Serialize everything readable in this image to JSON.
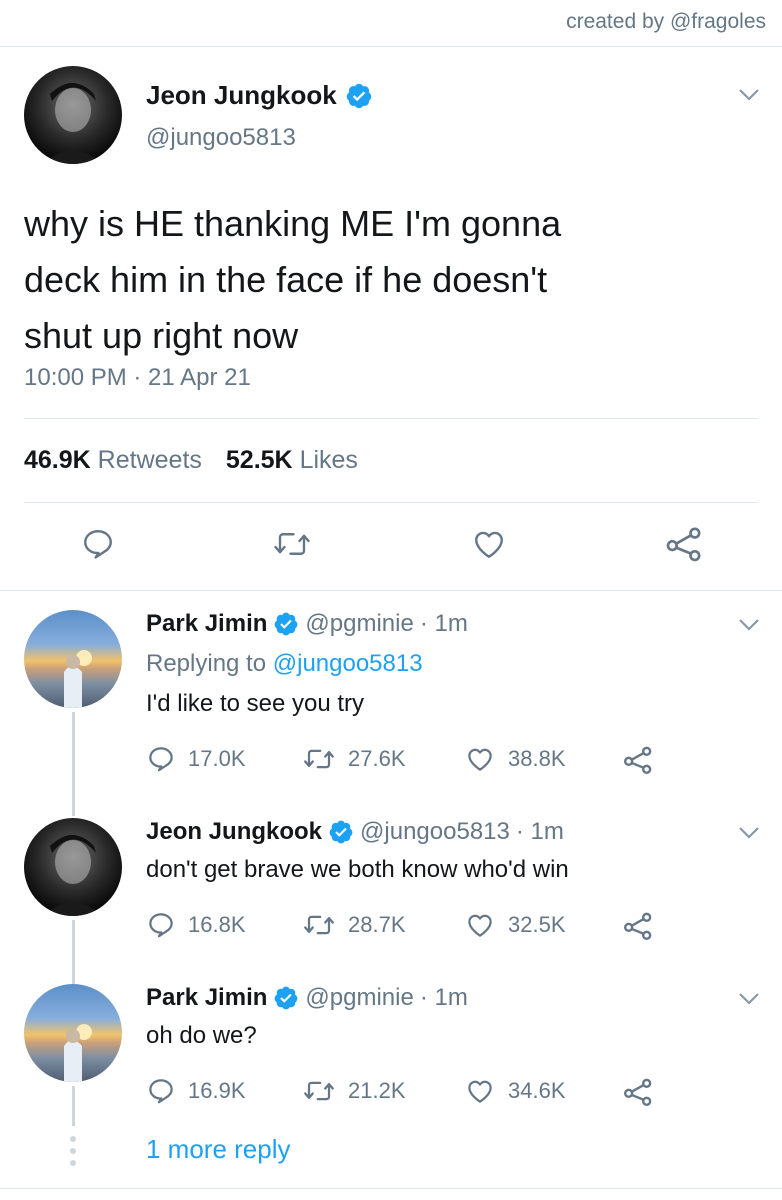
{
  "credit": "created by @fragoles",
  "main_tweet": {
    "name": "Jeon Jungkook",
    "handle": "@jungoo5813",
    "text_lines": [
      "why is HE thanking ME I'm gonna",
      "deck him in the face if he doesn't",
      "shut up right now"
    ],
    "timestamp": "10:00 PM · 21 Apr 21",
    "retweets_count": "46.9K",
    "retweets_label": "Retweets",
    "likes_count": "52.5K",
    "likes_label": "Likes"
  },
  "replies": [
    {
      "name": "Park Jimin",
      "handle": "@pgminie",
      "time": "· 1m",
      "replying_prefix": "Replying to",
      "replying_handle": "@jungoo5813",
      "text": "I'd like to see you try",
      "replies": "17.0K",
      "retweets": "27.6K",
      "likes": "38.8K"
    },
    {
      "name": "Jeon Jungkook",
      "handle": "@jungoo5813",
      "time": "· 1m",
      "text": "don't get brave we both know who'd win",
      "replies": "16.8K",
      "retweets": "28.7K",
      "likes": "32.5K"
    },
    {
      "name": "Park Jimin",
      "handle": "@pgminie",
      "time": "· 1m",
      "text": "oh do we?",
      "replies": "16.9K",
      "retweets": "21.2K",
      "likes": "34.6K"
    }
  ],
  "more_replies": "1 more reply",
  "colors": {
    "accent": "#1da1f2",
    "secondary_text": "#657786",
    "divider": "#e1e8ed",
    "verified": "#1da1f2"
  }
}
